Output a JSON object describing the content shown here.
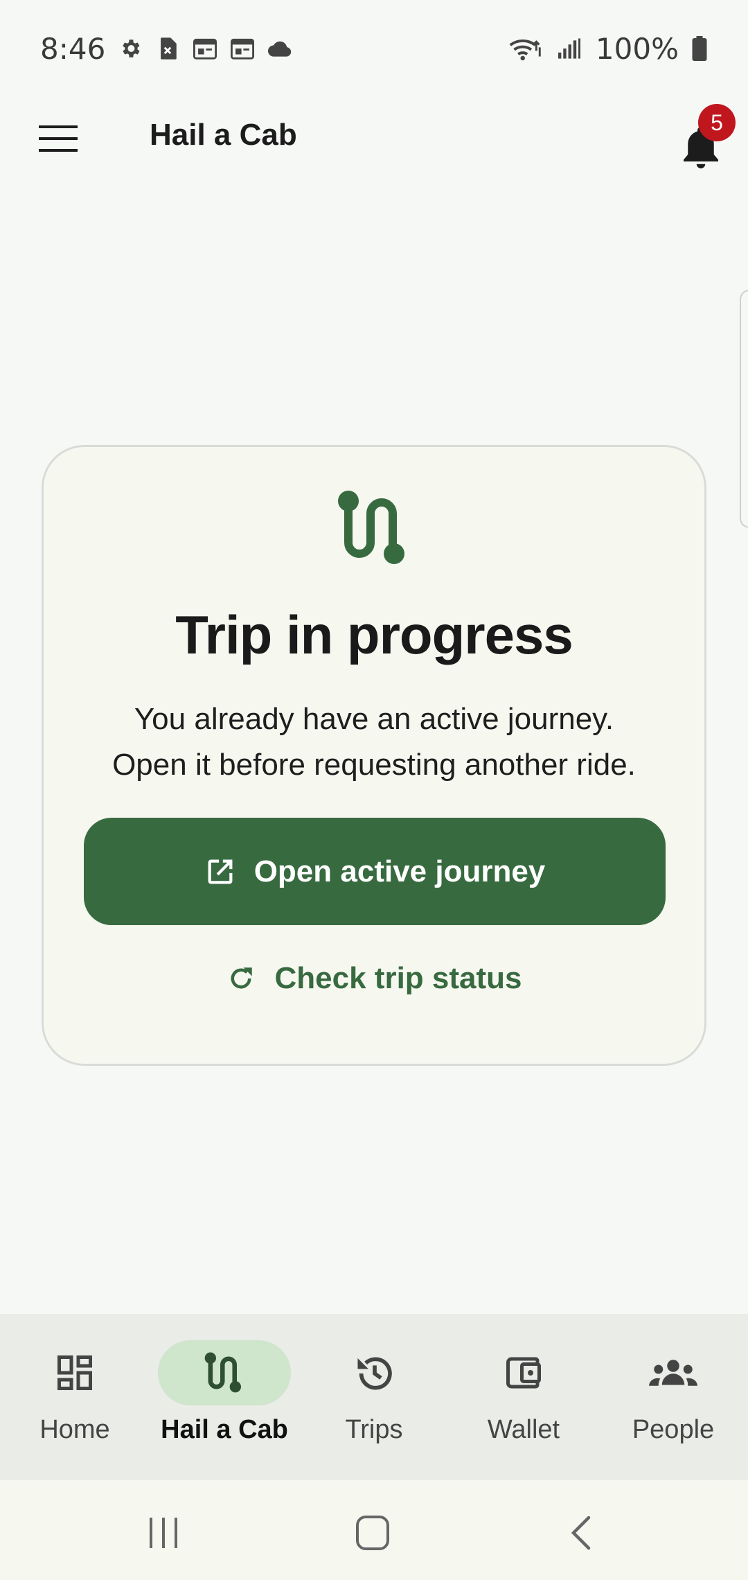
{
  "status_bar": {
    "time": "8:46",
    "battery": "100%"
  },
  "app_bar": {
    "title": "Hail a Cab",
    "notification_count": "5"
  },
  "card": {
    "title": "Trip in progress",
    "description_line1": "You already have an active journey.",
    "description_line2": "Open it before requesting another ride.",
    "primary_button": "Open active journey",
    "secondary_button": "Check trip status"
  },
  "bottom_nav": {
    "items": [
      {
        "label": "Home",
        "icon": "dashboard-icon",
        "active": false
      },
      {
        "label": "Hail a Cab",
        "icon": "route-icon",
        "active": true
      },
      {
        "label": "Trips",
        "icon": "history-icon",
        "active": false
      },
      {
        "label": "Wallet",
        "icon": "wallet-icon",
        "active": false
      },
      {
        "label": "People",
        "icon": "people-icon",
        "active": false
      }
    ]
  },
  "colors": {
    "accent": "#386a40",
    "badge": "#c0171f",
    "nav_active_pill": "#cfe5cc"
  }
}
